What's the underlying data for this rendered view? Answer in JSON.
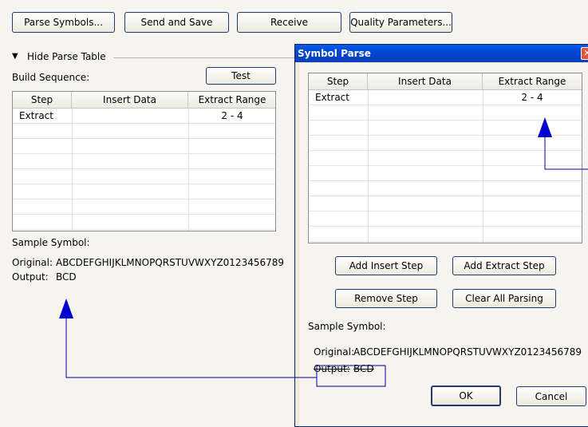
{
  "toolbar": {
    "parse_symbols": "Parse Symbols...",
    "send_and_save": "Send and Save",
    "receive": "Receive",
    "quality_parameters": "Quality Parameters..."
  },
  "left_panel": {
    "hide_parse_table": "Hide Parse Table",
    "build_sequence": "Build Sequence:",
    "test_button": "Test",
    "table": {
      "headers": [
        "Step",
        "Insert Data",
        "Extract Range"
      ],
      "rows": [
        [
          "Extract",
          "",
          "2 - 4"
        ]
      ]
    },
    "sample_symbol_label": "Sample Symbol:",
    "original_label": "Original:",
    "original_value": "ABCDEFGHIJKLMNOPQRSTUVWXYZ0123456789",
    "output_label": "Output:",
    "output_value": "BCD"
  },
  "dialog": {
    "title": "Symbol Parse",
    "close_glyph": "✕",
    "table": {
      "headers": [
        "Step",
        "Insert Data",
        "Extract Range"
      ],
      "rows": [
        [
          "Extract",
          "",
          "2 - 4"
        ]
      ]
    },
    "add_insert_step": "Add Insert Step",
    "add_extract_step": "Add Extract Step",
    "remove_step": "Remove Step",
    "clear_all_parsing": "Clear All Parsing",
    "sample_symbol_label": "Sample Symbol:",
    "original_label": "Original:",
    "original_value": "ABCDEFGHIJKLMNOPQRSTUVWXYZ0123456789",
    "output_label": "Output:",
    "output_value": "BCD",
    "ok": "OK",
    "cancel": "Cancel"
  },
  "annotation": {
    "arrow_color": "#0000d0",
    "line_color": "#0000a0"
  }
}
